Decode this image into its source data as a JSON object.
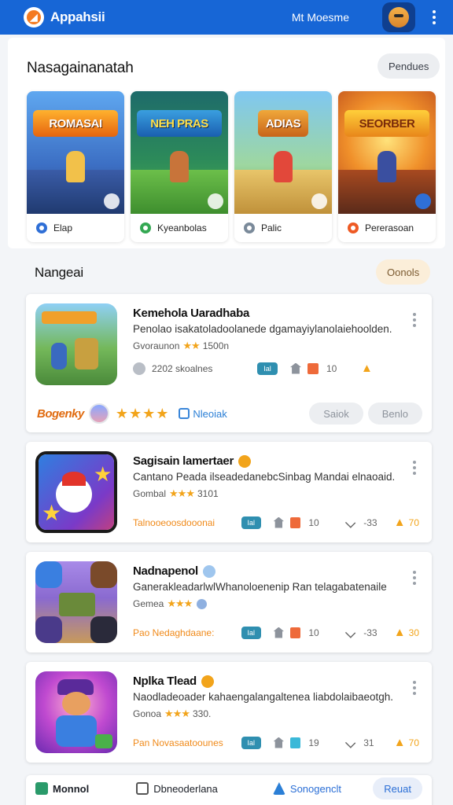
{
  "appbar": {
    "title": "Appahsii",
    "link": "Mt Moesme"
  },
  "featured": {
    "title": "Nasagainanatah",
    "action": "Pendues",
    "cards": [
      {
        "banner": "ROMASAI",
        "caption": "Elap",
        "dot_color": "#2f6fd6"
      },
      {
        "banner": "NEH PRAS",
        "caption": "Kyeanbolas",
        "dot_color": "#34a853"
      },
      {
        "banner": "ADIAS",
        "caption": "Palic",
        "dot_color": "#7a8a9a"
      },
      {
        "banner": "SEORBER",
        "caption": "Pererasoan",
        "dot_color": "#ee5a24"
      }
    ]
  },
  "list": {
    "title": "Nangeai",
    "action": "Oonols",
    "items": [
      {
        "title": "Kemehola Uaradhaba",
        "desc": "Penolao isakatoladoolanede dgamayiylanolaiehoolden.",
        "rating_label": "Gvoraunon",
        "stars": "★★",
        "rating_value": "1500n",
        "installs": "2202 skoalnes",
        "chip": "Ial",
        "count1": "10",
        "footer_brand": "Bogenky",
        "footer_stars": "★★★★",
        "footer_link": "Nleoiak",
        "btn1": "Saiok",
        "btn2": "Benlo"
      },
      {
        "title": "Sagisain lamertaer",
        "desc": "Cantano Peada ilseadedanebcSinbag Mandai elnaoaid.",
        "rating_label": "Gombal",
        "stars": "★★★",
        "rating_value": "3101",
        "tag": "Talnooeoosdooonai",
        "chip": "Ial",
        "count1": "10",
        "count2": "-33",
        "count3": "70"
      },
      {
        "title": "Nadnapenol",
        "desc": "GanerakleadarlwlWhanoloenenip Ran telagabatenaile",
        "rating_label": "Gemea",
        "stars": "★★★",
        "tag": "Pao Nedaghdaane:",
        "chip": "Ial",
        "count1": "10",
        "count2": "-33",
        "count3": "30"
      },
      {
        "title": "Nplka Tlead",
        "desc": "Naodladeoader kahaengalangaltenea liabdolaibaeotgh.",
        "rating_label": "Gonoa",
        "stars": "★★★",
        "rating_value": "330.",
        "tag": "Pan Novasaatoounes",
        "chip": "Ial",
        "count1": "19",
        "count2": "31",
        "count3": "70"
      }
    ]
  },
  "bottom": {
    "left": "Monnol",
    "middle": "Dbneoderlana",
    "right": "Sonogenclt",
    "button": "Reuat"
  }
}
